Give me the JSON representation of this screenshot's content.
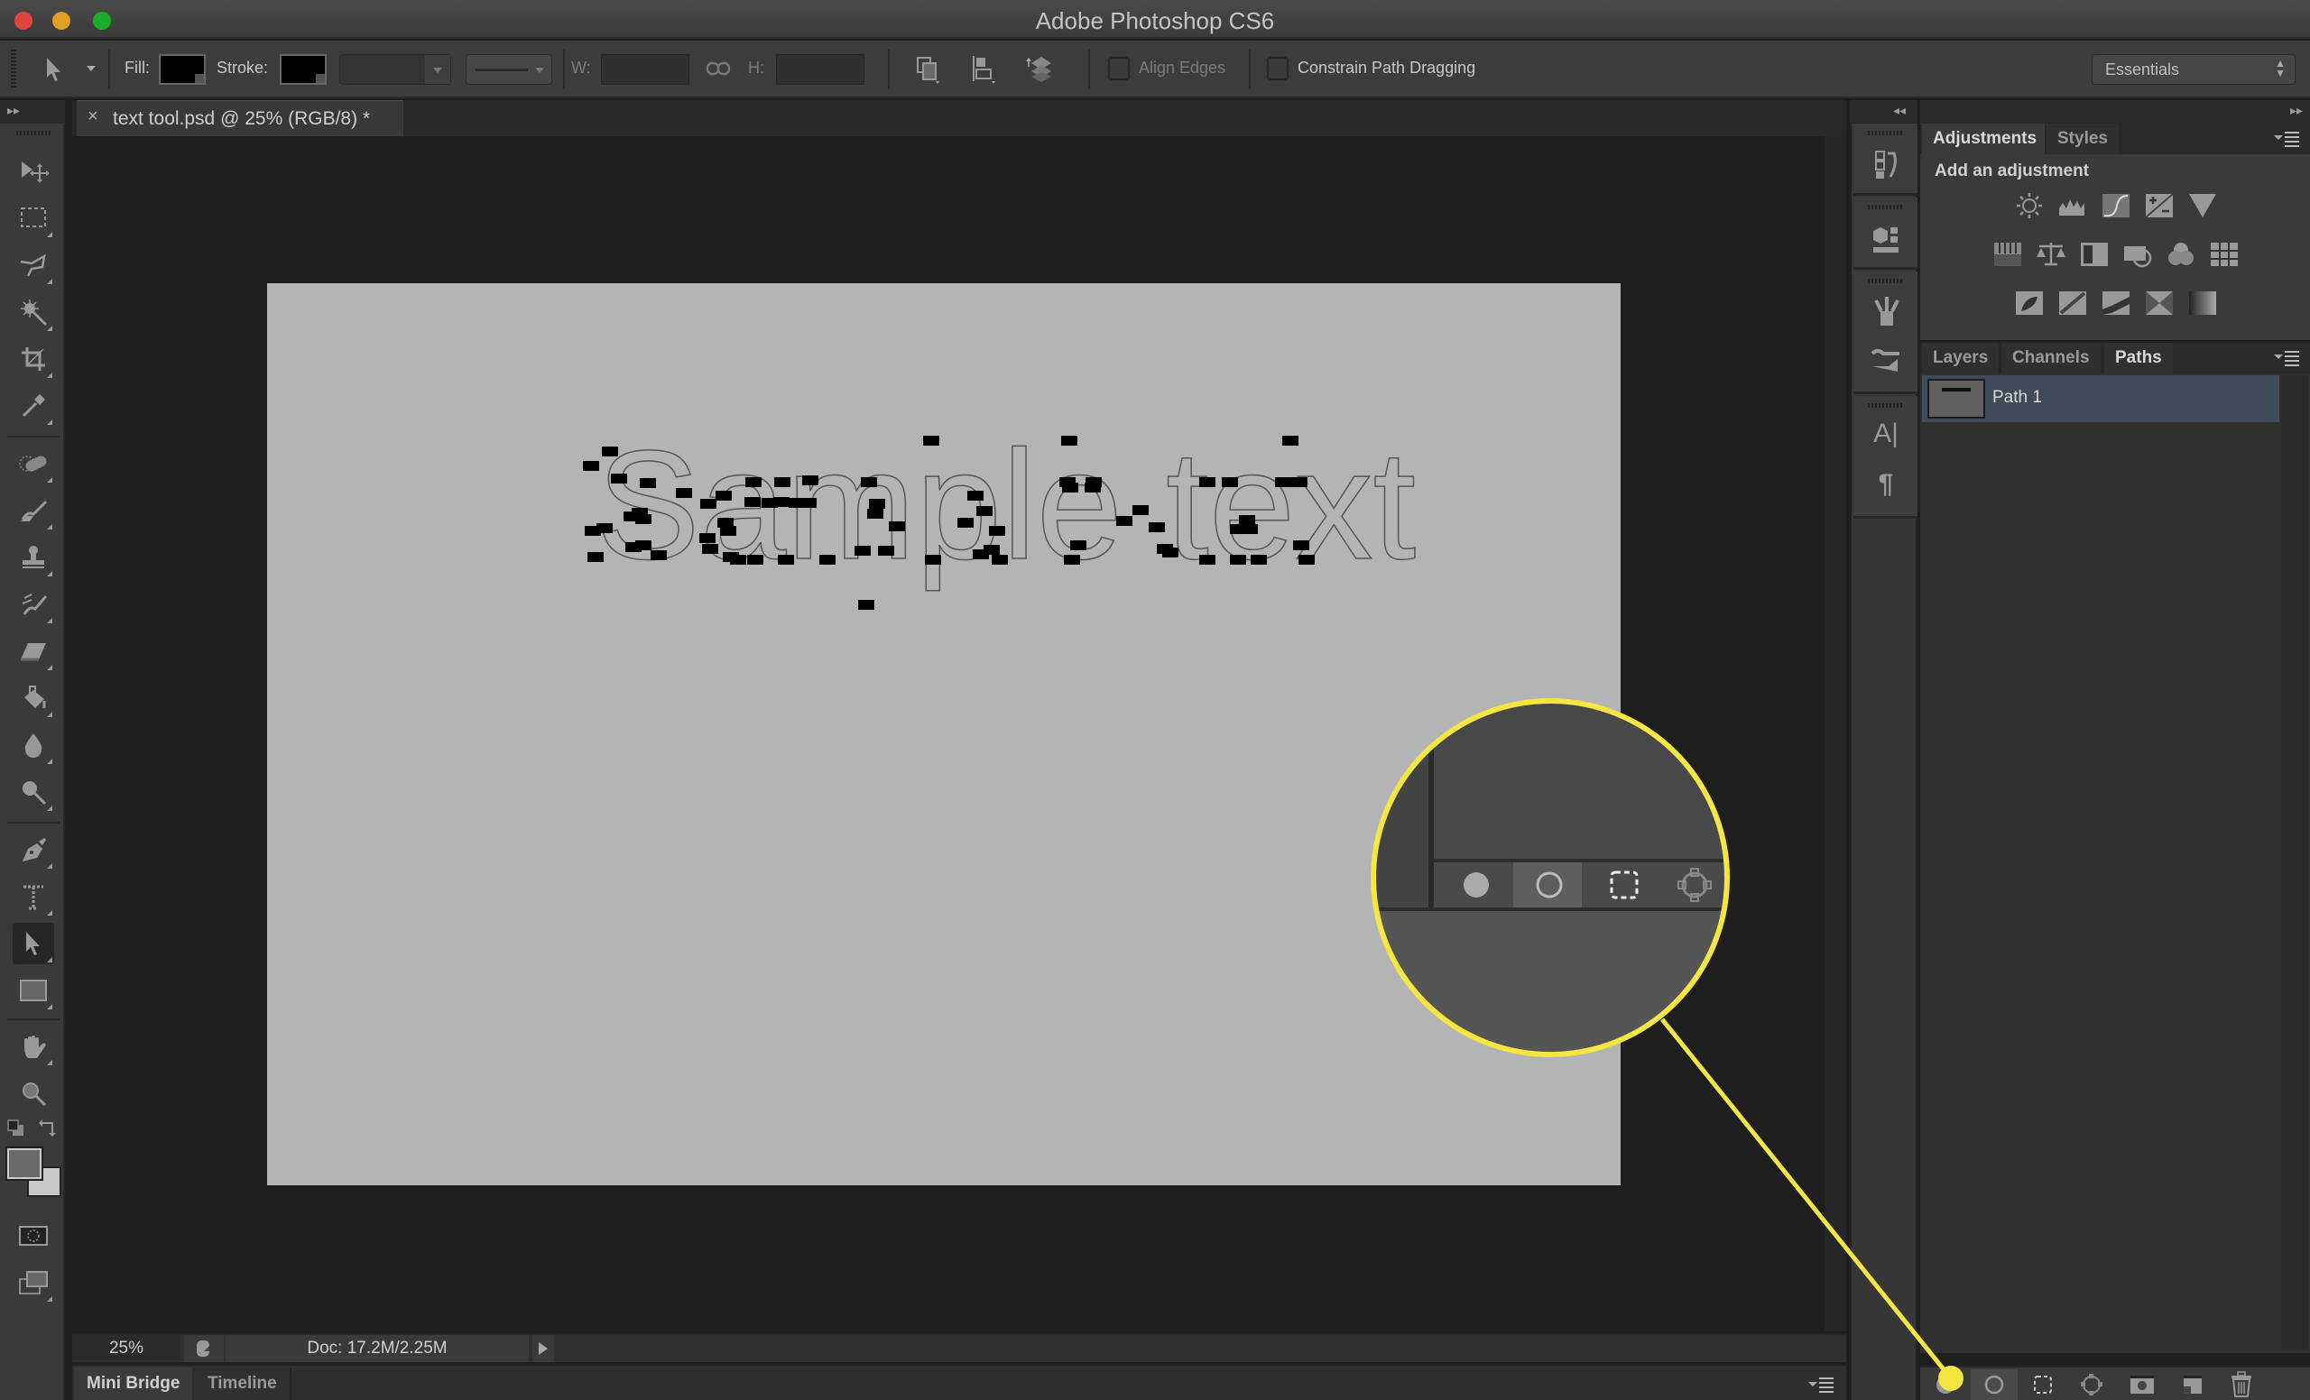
{
  "window": {
    "title": "Adobe Photoshop CS6",
    "traffic_lights": {
      "close": "#e0443e",
      "minimize": "#dea123",
      "zoom": "#1aab29"
    }
  },
  "options_bar": {
    "tool_icon": "path-selection-arrow-icon",
    "fill_label": "Fill:",
    "stroke_label": "Stroke:",
    "fill_color": "#000000",
    "stroke_color": "#000000",
    "stroke_width_value": "",
    "stroke_type_value": "",
    "w_label": "W:",
    "w_value": "",
    "h_label": "H:",
    "h_value": "",
    "align_edges_label": "Align Edges",
    "align_edges_checked": false,
    "constrain_label": "Constrain Path Dragging",
    "constrain_checked": false,
    "workspace_value": "Essentials"
  },
  "document": {
    "tab_label": "text tool.psd @ 25% (RGB/8) *",
    "close_glyph": "×",
    "canvas_text": "Sample text",
    "canvas_color": "#b4b4b4"
  },
  "tools": [
    {
      "name": "move-tool",
      "active": false
    },
    {
      "name": "rectangular-marquee-tool",
      "active": false
    },
    {
      "name": "polygonal-lasso-tool",
      "active": false
    },
    {
      "name": "magic-wand-tool",
      "active": false
    },
    {
      "name": "crop-tool",
      "active": false
    },
    {
      "name": "eyedropper-tool",
      "active": false
    },
    {
      "name": "spot-healing-brush-tool",
      "active": false
    },
    {
      "name": "brush-tool",
      "active": false
    },
    {
      "name": "clone-stamp-tool",
      "active": false
    },
    {
      "name": "history-brush-tool",
      "active": false
    },
    {
      "name": "eraser-tool",
      "active": false
    },
    {
      "name": "paint-bucket-tool",
      "active": false
    },
    {
      "name": "blur-tool",
      "active": false
    },
    {
      "name": "dodge-tool",
      "active": false
    },
    {
      "name": "pen-tool",
      "active": false
    },
    {
      "name": "type-mask-tool",
      "active": false
    },
    {
      "name": "path-selection-tool",
      "active": true
    },
    {
      "name": "rectangle-tool",
      "active": false
    },
    {
      "name": "hand-tool",
      "active": false
    },
    {
      "name": "zoom-tool",
      "active": false
    }
  ],
  "colors": {
    "foreground": "#6a6a6a",
    "background": "#c8c8c8"
  },
  "status_bar": {
    "zoom": "25%",
    "doc_info": "Doc: 17.2M/2.25M"
  },
  "bottom_tabs": [
    {
      "label": "Mini Bridge",
      "active": true
    },
    {
      "label": "Timeline",
      "active": false
    }
  ],
  "dock_icons": [
    "history-icon",
    "3d-properties-icon",
    "brush-presets-icon",
    "brush-settings-icon",
    "character-icon",
    "paragraph-icon"
  ],
  "adjustments_panel": {
    "tabs": [
      {
        "label": "Adjustments",
        "active": true
      },
      {
        "label": "Styles",
        "active": false
      }
    ],
    "heading": "Add an adjustment",
    "rows": [
      [
        "brightness-contrast-icon",
        "levels-icon",
        "curves-icon",
        "exposure-icon",
        "vibrance-icon"
      ],
      [
        "hue-saturation-icon",
        "color-balance-icon",
        "black-white-icon",
        "photo-filter-icon",
        "channel-mixer-icon",
        "color-lookup-icon"
      ],
      [
        "invert-icon",
        "posterize-icon",
        "threshold-icon",
        "selective-color-icon",
        "gradient-map-icon"
      ]
    ]
  },
  "paths_panel": {
    "tabs": [
      {
        "label": "Layers",
        "active": false
      },
      {
        "label": "Channels",
        "active": false
      },
      {
        "label": "Paths",
        "active": true
      }
    ],
    "items": [
      {
        "name": "Path 1",
        "selected": true
      }
    ],
    "footer_buttons": [
      "fill-path-icon",
      "stroke-path-icon",
      "load-path-as-selection-icon",
      "make-work-path-icon",
      "add-mask-icon",
      "new-path-icon",
      "delete-path-icon"
    ]
  },
  "callout": {
    "color": "#f5e642",
    "highlighted_button": "fill-path-icon"
  }
}
